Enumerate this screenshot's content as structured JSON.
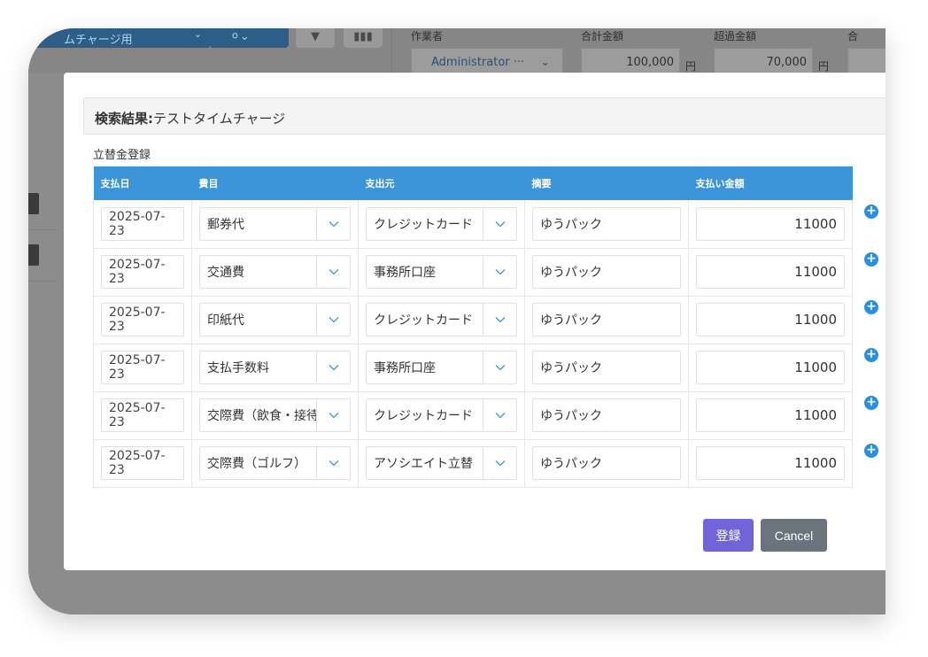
{
  "background": {
    "select_label": "ムチャージ用",
    "filter_icon": "filter-icon",
    "columns_icon": "columns-icon",
    "fields": [
      {
        "label": "作業者",
        "value": "Administrator ···"
      },
      {
        "label": "合計金額",
        "value": "100,000",
        "unit": "円"
      },
      {
        "label": "超過金額",
        "value": "70,000",
        "unit": "円"
      },
      {
        "label": "合"
      }
    ]
  },
  "modal": {
    "result_prefix": "検索結果:",
    "result_title": "テストタイムチャージ",
    "section_title": "立替金登録",
    "columns": [
      "支払日",
      "費目",
      "支出元",
      "摘要",
      "支払い金額"
    ],
    "rows": [
      {
        "date": "2025-07-23",
        "category": "郵券代",
        "source": "クレジットカード",
        "summary": "ゆうパック",
        "amount": "11000"
      },
      {
        "date": "2025-07-23",
        "category": "交通費",
        "source": "事務所口座",
        "summary": "ゆうパック",
        "amount": "11000"
      },
      {
        "date": "2025-07-23",
        "category": "印紙代",
        "source": "クレジットカード",
        "summary": "ゆうパック",
        "amount": "11000"
      },
      {
        "date": "2025-07-23",
        "category": "支払手数料",
        "source": "事務所口座",
        "summary": "ゆうパック",
        "amount": "11000"
      },
      {
        "date": "2025-07-23",
        "category": "交際費（飲食・接待）",
        "source": "クレジットカード",
        "summary": "ゆうパック",
        "amount": "11000"
      },
      {
        "date": "2025-07-23",
        "category": "交際費（ゴルフ）",
        "source": "アソシエイト立替",
        "summary": "ゆうパック",
        "amount": "11000"
      }
    ],
    "add_row_icon": "plus-circle-icon",
    "register_label": "登録",
    "cancel_label": "Cancel"
  },
  "colors": {
    "header_blue": "#3d95d9",
    "register": "#6f64d8",
    "cancel": "#6b747c",
    "plus": "#2a8fe0"
  }
}
